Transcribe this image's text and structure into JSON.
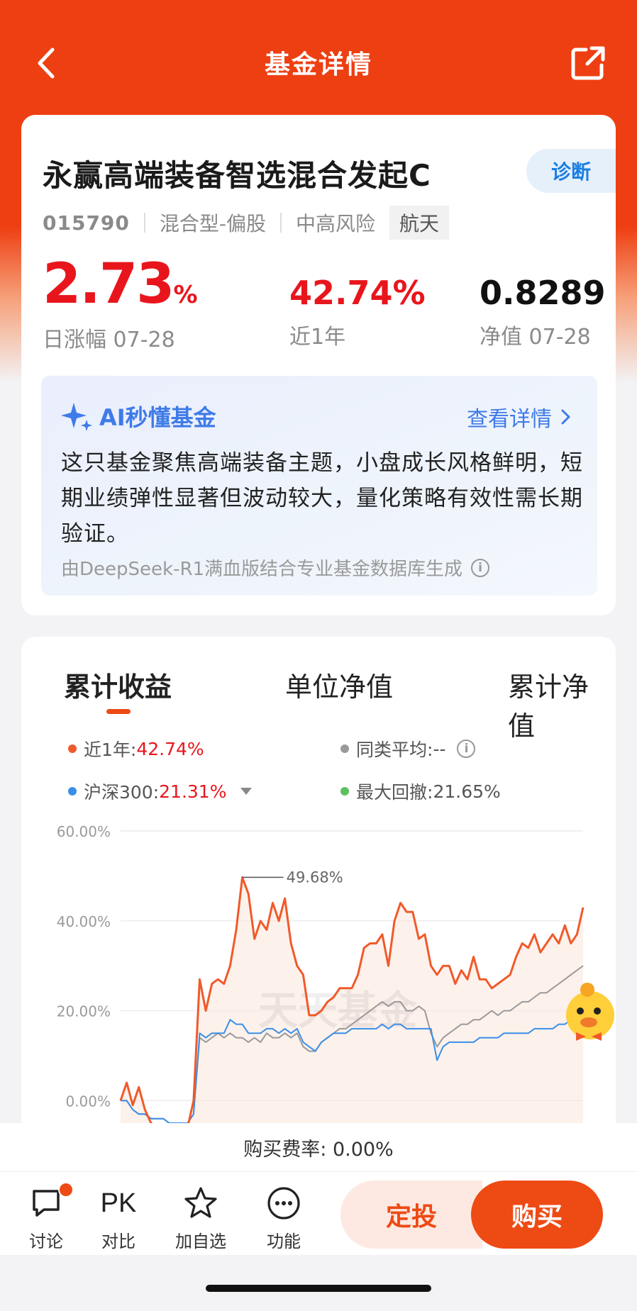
{
  "header": {
    "title": "基金详情"
  },
  "fund": {
    "name": "永赢高端装备智选混合发起C",
    "diagnose_label": "诊断",
    "code": "015790",
    "type": "混合型-偏股",
    "risk": "中高风险",
    "sector_tag": "航天",
    "daily_change": "2.73",
    "daily_change_unit": "%",
    "daily_change_label": "日涨幅 07-28",
    "one_year_return": "42.74%",
    "one_year_label": "近1年",
    "nav": "0.8289",
    "nav_label": "净值 07-28"
  },
  "ai_summary": {
    "title": "AI秒懂基金",
    "more_label": "查看详情",
    "body": "这只基金聚焦高端装备主题，小盘成长风格鲜明，短期业绩弹性显著但波动较大，量化策略有效性需长期验证。",
    "source": "由DeepSeek-R1满血版结合专业基金数据库生成"
  },
  "chart_tabs": [
    "累计收益",
    "单位净值",
    "累计净值"
  ],
  "legend": {
    "fund_label": "近1年:",
    "fund_value": "42.74%",
    "avg_label": "同类平均:",
    "avg_value": "--",
    "index_label": "沪深300:",
    "index_value": "21.31%",
    "drawdown_label": "最大回撤:",
    "drawdown_value": "21.65%"
  },
  "colors": {
    "fund": "#f05a2a",
    "index": "#3a8fe8",
    "average": "#9a9a9a",
    "drawdown": "#5cc15c",
    "accent": "#ee4a14"
  },
  "chart_data": {
    "type": "line",
    "y_ticks": [
      "60.00%",
      "40.00%",
      "20.00%",
      "0.00%"
    ],
    "ylim": [
      -5,
      60
    ],
    "peak_annotation": "49.68%",
    "watermark": "天天基金",
    "series": [
      {
        "name": "近1年",
        "values": [
          0,
          4,
          -1,
          3,
          -2,
          -5,
          -6,
          -6,
          -6,
          -7,
          -7,
          -6,
          0,
          27,
          20,
          26,
          27,
          26,
          30,
          38,
          49.68,
          46,
          36,
          40,
          38,
          44,
          40,
          45,
          35,
          30,
          28,
          19,
          19,
          20,
          22,
          23,
          25,
          25,
          25,
          28,
          34,
          35,
          35,
          37,
          30,
          40,
          44,
          42,
          42,
          36,
          37,
          30,
          28,
          30,
          30,
          26,
          29,
          27,
          32,
          27,
          27,
          25,
          26,
          27,
          28,
          32,
          35,
          34,
          37,
          33,
          35,
          37,
          35,
          39,
          35,
          37,
          43
        ]
      },
      {
        "name": "沪深300",
        "values": [
          0,
          0,
          -2,
          -3,
          -3,
          -4,
          -4,
          -4,
          -5,
          -5,
          -5,
          -5,
          -3,
          15,
          14,
          15,
          15,
          15,
          18,
          17,
          17,
          15,
          15,
          15,
          16,
          16,
          15,
          16,
          15,
          16,
          13,
          12,
          11,
          13,
          14,
          15,
          15,
          15,
          16,
          16,
          16,
          16,
          16,
          17,
          16,
          17,
          17,
          16,
          16,
          16,
          16,
          16,
          9,
          12,
          13,
          13,
          13,
          13,
          13,
          14,
          14,
          14,
          14,
          15,
          15,
          15,
          15,
          15,
          16,
          16,
          16,
          16,
          17,
          17,
          18,
          18,
          19
        ]
      },
      {
        "name": "同类平均",
        "values": [
          0,
          0,
          -2,
          -3,
          -3,
          -4,
          -4,
          -4,
          -5,
          -5,
          -5,
          -5,
          -3,
          14,
          13,
          14,
          15,
          14,
          15,
          14,
          14,
          13,
          14,
          13,
          15,
          14,
          14,
          15,
          14,
          15,
          12,
          11,
          11,
          13,
          14,
          15,
          16,
          16,
          17,
          18,
          19,
          20,
          21,
          22,
          21,
          22,
          22,
          20,
          20,
          21,
          20,
          15,
          12,
          14,
          15,
          16,
          17,
          17,
          18,
          18,
          19,
          20,
          19,
          20,
          20,
          21,
          22,
          22,
          23,
          24,
          24,
          25,
          26,
          27,
          28,
          29,
          30
        ]
      }
    ]
  },
  "fee": {
    "text": "购买费率: 0.00%"
  },
  "bottom_nav": {
    "discuss": "讨论",
    "pk_symbol": "PK",
    "compare": "对比",
    "watchlist": "加自选",
    "functions": "功能",
    "sip": "定投",
    "buy": "购买"
  }
}
